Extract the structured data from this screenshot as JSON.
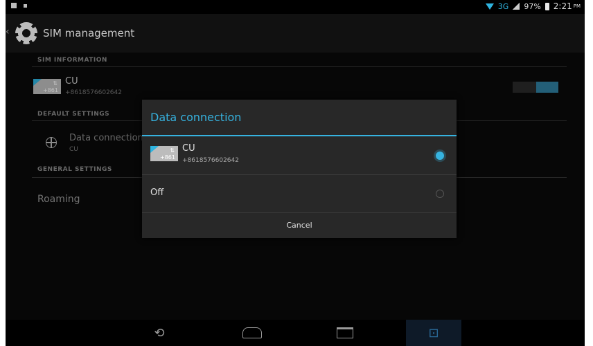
{
  "status_bar": {
    "network": "3G",
    "battery": "97%",
    "time": "2:21",
    "ampm": "PM"
  },
  "action_bar": {
    "title": "SIM management"
  },
  "settings": {
    "sim_information_header": "SIM INFORMATION",
    "sim": {
      "name": "CU",
      "number": "+8618576602642",
      "code": "+861"
    },
    "default_settings_header": "DEFAULT SETTINGS",
    "data_connection": {
      "label": "Data connection",
      "value": "CU"
    },
    "general_settings_header": "GENERAL SETTINGS",
    "roaming_label": "Roaming"
  },
  "dialog": {
    "title": "Data connection",
    "options": [
      {
        "name": "CU",
        "number": "+8618576602642",
        "code": "+861",
        "selected": true
      },
      {
        "name": "Off",
        "selected": false
      }
    ],
    "cancel_label": "Cancel"
  },
  "colors": {
    "accent": "#36b3e0",
    "background": "#0a0a0a",
    "dialog_bg": "#282828"
  }
}
